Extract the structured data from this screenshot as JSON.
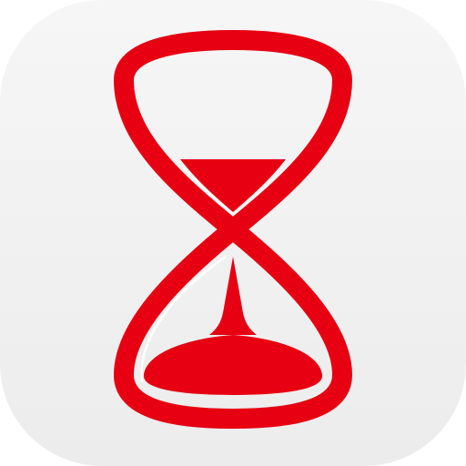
{
  "app_icon": {
    "icon": "hourglass-icon",
    "colors": {
      "background_top": "#f6f6f6",
      "background_bottom": "#ececec",
      "accent": "#e60012",
      "highlight": "#ffffff"
    }
  }
}
